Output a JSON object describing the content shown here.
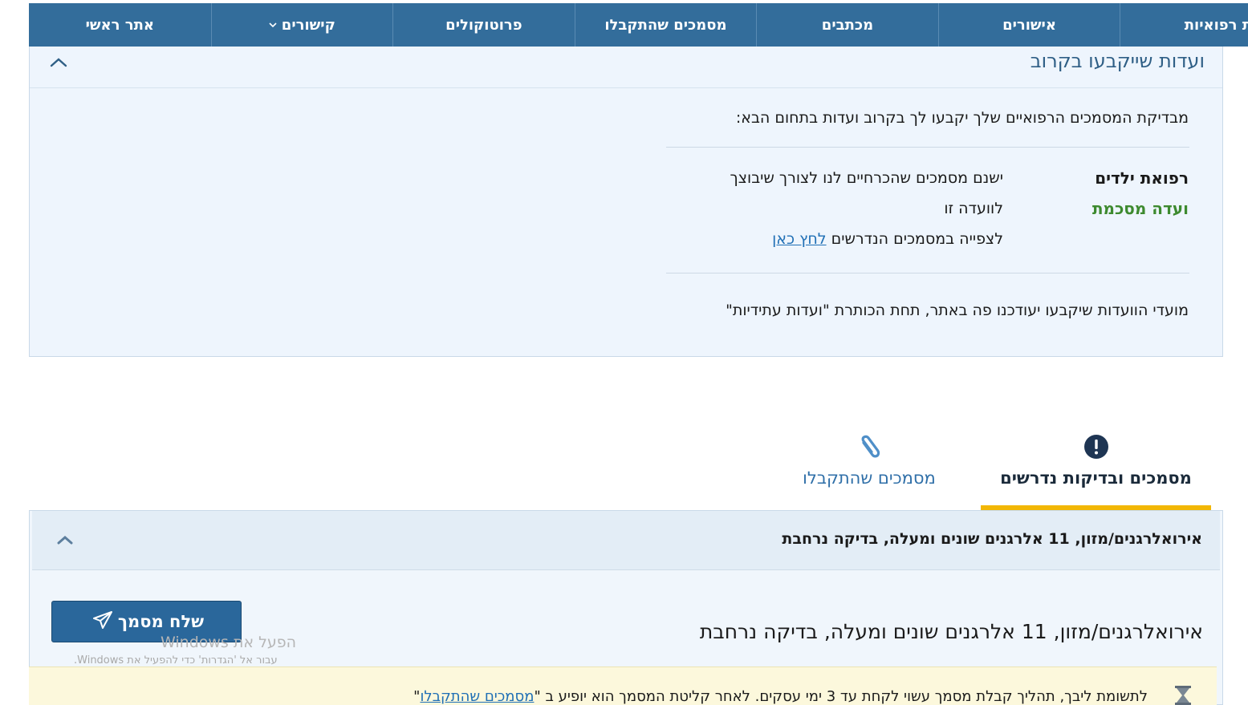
{
  "nav": {
    "items": [
      {
        "label": "אתר ראשי"
      },
      {
        "label": "קישורים",
        "has_dropdown": true
      },
      {
        "label": "פרוטוקולים"
      },
      {
        "label": "מסמכים שהתקבלו"
      },
      {
        "label": "מכתבים"
      },
      {
        "label": "אישורים"
      },
      {
        "label": "ועדות רפואיות"
      }
    ]
  },
  "upcoming": {
    "title": "ועדות שייקבעו בקרוב",
    "intro": "מבדיקת המסמכים הרפואיים שלך יקבעו לך בקרוב ועדות בתחום הבא:",
    "specialty": "רפואת ילדים",
    "committee_type": "ועדה מסכמת",
    "line1": "ישנם מסמכים שהכרחיים לנו לצורך שיבוצך",
    "line2": "לוועדה זו",
    "line3_prefix": "לצפייה במסמכים הנדרשים",
    "line3_link": "לחץ כאן",
    "footer": "מועדי הוועדות שיקבעו יעודכנו פה באתר, תחת הכותרת \"ועדות עתידיות\""
  },
  "tabs": {
    "required": "מסמכים ובדיקות נדרשים",
    "received": "מסמכים שהתקבלו"
  },
  "test": {
    "title": "אירואלרגנים/מזון, 11 אלרגנים שונים ומעלה, בדיקה נרחבת",
    "subtitle": "אירואלרגנים/מזון, 11 אלרגנים שונים ומעלה, בדיקה נרחבת",
    "send_button": "שלח מסמך"
  },
  "watermark": {
    "line1": "הפעל את Windows",
    "line2": "עבור אל 'הגדרות' כדי להפעיל את Windows."
  },
  "notice": {
    "text_prefix": "לתשומת ליבך, תהליך קבלת מסמך עשוי לקחת עד 3 ימי עסקים. לאחר קליטת המסמך הוא יופיע ב \"",
    "link": "מסמכים שהתקבלו",
    "text_suffix": "\""
  },
  "colors": {
    "nav_bg": "#336d9b",
    "panel_bg": "#eef5fd",
    "accent_yellow": "#f2b705",
    "committee_green": "#3d8a2f",
    "link_blue": "#1f6fb5",
    "button_blue": "#2a679b"
  },
  "icons": {
    "collapse": "chevron-up-icon",
    "tab_required": "exclamation-circle-icon",
    "tab_received": "paperclip-icon",
    "send": "paper-plane-icon",
    "notice": "hourglass-icon"
  }
}
